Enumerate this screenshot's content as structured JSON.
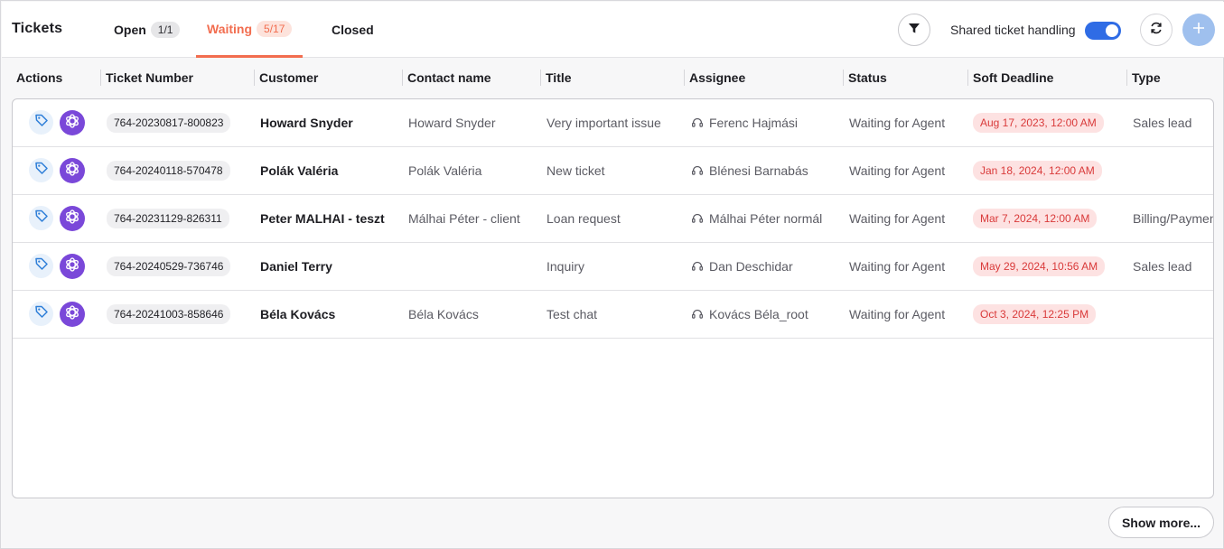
{
  "header": {
    "title": "Tickets",
    "tabs": [
      {
        "label": "Open",
        "count": "1/1"
      },
      {
        "label": "Waiting",
        "count": "5/17"
      },
      {
        "label": "Closed"
      }
    ],
    "shared_label": "Shared ticket handling",
    "shared_enabled": true
  },
  "columns": [
    "Actions",
    "Ticket Number",
    "Customer",
    "Contact name",
    "Title",
    "Assignee",
    "Status",
    "Soft Deadline",
    "Type"
  ],
  "rows": [
    {
      "ticket": "764-20230817-800823",
      "customer": "Howard Snyder",
      "contact": "Howard Snyder",
      "title": "Very important issue",
      "assignee": "Ferenc Hajmási",
      "status": "Waiting for Agent",
      "deadline": "Aug 17, 2023, 12:00 AM",
      "type": "Sales lead"
    },
    {
      "ticket": "764-20240118-570478",
      "customer": "Polák Valéria",
      "contact": "Polák Valéria",
      "title": "New ticket",
      "assignee": "Blénesi Barnabás",
      "status": "Waiting for Agent",
      "deadline": "Jan 18, 2024, 12:00 AM",
      "type": ""
    },
    {
      "ticket": "764-20231129-826311",
      "customer": "Peter MALHAI - teszt",
      "contact": "Málhai Péter - client",
      "title": "Loan request",
      "assignee": "Málhai Péter normál",
      "status": "Waiting for Agent",
      "deadline": "Mar 7, 2024, 12:00 AM",
      "type": "Billing/Paymen"
    },
    {
      "ticket": "764-20240529-736746",
      "customer": "Daniel Terry",
      "contact": "",
      "title": "Inquiry",
      "assignee": "Dan Deschidar",
      "status": "Waiting for Agent",
      "deadline": "May 29, 2024, 10:56 AM",
      "type": "Sales lead"
    },
    {
      "ticket": "764-20241003-858646",
      "customer": "Béla Kovács",
      "contact": "Béla Kovács",
      "title": "Test chat",
      "assignee": "Kovács Béla_root",
      "status": "Waiting for Agent",
      "deadline": "Oct 3, 2024, 12:25 PM",
      "type": ""
    }
  ],
  "footer": {
    "show_more_label": "Show more..."
  },
  "colors": {
    "accent": "#f26d4f",
    "toggle": "#2f6ce5",
    "ai": "#7a48d9",
    "deadline_text": "#d93a3a",
    "deadline_bg": "#fde2e2"
  },
  "icons": {
    "tag": "tag-icon",
    "ai": "openai-icon",
    "filter": "filter-icon",
    "refresh": "refresh-icon",
    "add": "plus-icon",
    "assignee": "headset-icon"
  }
}
